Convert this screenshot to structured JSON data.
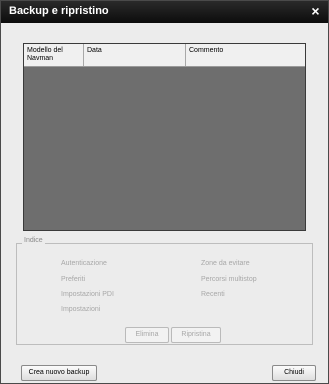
{
  "window": {
    "title": "Backup e ripristino",
    "close_symbol": "×"
  },
  "table": {
    "columns": [
      "Modello del Navman",
      "Data",
      "Commento"
    ]
  },
  "index": {
    "label": "Indice",
    "left_items": [
      "Autenticazione",
      "Preferiti",
      "Impostazioni PDI",
      "Impostazioni"
    ],
    "right_items": [
      "Zone da evitare",
      "Percorsi multistop",
      "Recenti"
    ]
  },
  "actions": {
    "delete": "Elimina",
    "restore": "Ripristina"
  },
  "footer": {
    "new_backup": "Crea nuovo backup",
    "close": "Chiudi"
  }
}
